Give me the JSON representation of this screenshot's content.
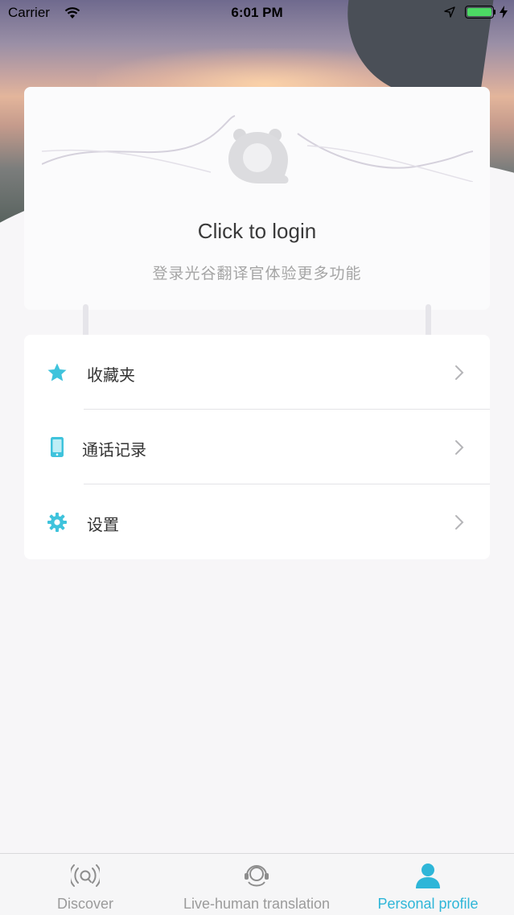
{
  "status_bar": {
    "carrier": "Carrier",
    "time": "6:01 PM",
    "battery_color": "#4cd964"
  },
  "login": {
    "title": "Click to login",
    "subtitle": "登录光谷翻译官体验更多功能",
    "avatar_icon": "bear-avatar-icon"
  },
  "menu": {
    "items": [
      {
        "label": "收藏夹",
        "icon": "star-icon",
        "color": "#3fc3dc"
      },
      {
        "label": "通话记录",
        "icon": "phone-icon",
        "color": "#3fc3dc"
      },
      {
        "label": "设置",
        "icon": "gear-icon",
        "color": "#3fc3dc"
      }
    ]
  },
  "tab_bar": {
    "tabs": [
      {
        "label": "Discover",
        "icon": "signal-icon",
        "active": false
      },
      {
        "label": "Live-human translation",
        "icon": "headset-icon",
        "active": false
      },
      {
        "label": "Personal profile",
        "icon": "person-icon",
        "active": true
      }
    ],
    "active_color": "#2eb6d8",
    "inactive_color": "#9b9b9b"
  }
}
